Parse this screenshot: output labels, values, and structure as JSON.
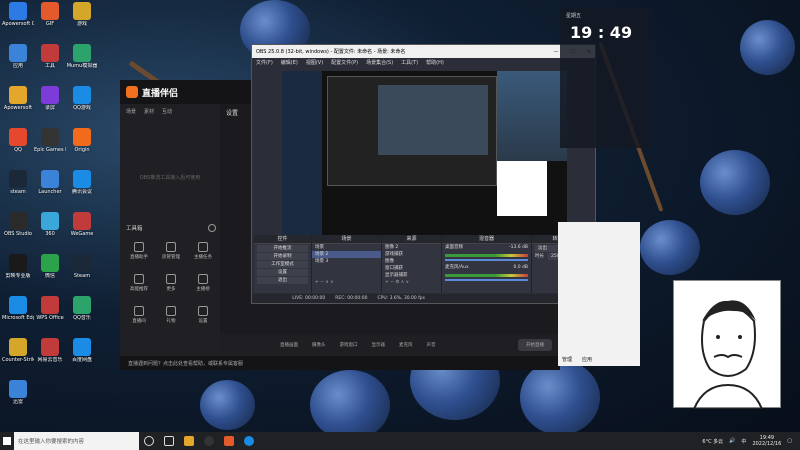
{
  "desktop": {
    "icons": [
      {
        "label": "Apowersoft GIF",
        "color": "#2c7be5"
      },
      {
        "label": "GIF",
        "color": "#e55a2c"
      },
      {
        "label": "游戏",
        "color": "#d4a62a"
      },
      {
        "label": "应用",
        "color": "#3b83d9"
      },
      {
        "label": "工具",
        "color": "#c23b3b"
      },
      {
        "label": "Mumu模拟器",
        "color": "#2ca36b"
      },
      {
        "label": "Apowersoft",
        "color": "#e5a62c"
      },
      {
        "label": "录屏",
        "color": "#7d3bd9"
      },
      {
        "label": "QQ游戏",
        "color": "#1b8ce5"
      },
      {
        "label": "QQ",
        "color": "#e5482c"
      },
      {
        "label": "Epic Games Launcher",
        "color": "#333333"
      },
      {
        "label": "Origin",
        "color": "#f26a1b"
      },
      {
        "label": "steam",
        "color": "#1b2838"
      },
      {
        "label": "Launcher",
        "color": "#3b83d9"
      },
      {
        "label": "腾讯会议",
        "color": "#1b8ce5"
      },
      {
        "label": "OBS Studio",
        "color": "#2a2a2a"
      },
      {
        "label": "360",
        "color": "#3ba6d9"
      },
      {
        "label": "WeGame",
        "color": "#c23b3b"
      },
      {
        "label": "剪映专业版",
        "color": "#1a1a1a"
      },
      {
        "label": "微信",
        "color": "#2ca34a"
      },
      {
        "label": "Steam",
        "color": "#1b2838"
      },
      {
        "label": "Microsoft Edge",
        "color": "#1b8ce5"
      },
      {
        "label": "WPS Office",
        "color": "#c23b3b"
      },
      {
        "label": "QQ音乐",
        "color": "#2ca36b"
      },
      {
        "label": "Counter-Strike: Global Offensive",
        "color": "#d4a62a"
      },
      {
        "label": "网易云音乐",
        "color": "#c23b3b"
      },
      {
        "label": "百度网盘",
        "color": "#1b8ce5"
      },
      {
        "label": "迅雷",
        "color": "#3b83d9"
      }
    ]
  },
  "companion": {
    "logo": "直播伴侣",
    "tabs": [
      "场景",
      "素材",
      "互动"
    ],
    "sidebar_heading": "工具箱",
    "tools": [
      "直播助手",
      "房管管理",
      "主播任务",
      "高能推荐",
      "更多",
      "主播榜",
      "直播间",
      "礼物",
      "设置"
    ],
    "empty_hint": "OBS推流工具接入后可使用",
    "status_text": "直播遇到问题？点击此处查看帮助，或联系专属客服",
    "bottom_buttons": [
      "直播画面",
      "摄像头",
      "游戏窗口",
      "显示器",
      "麦克风",
      "声音",
      "开始直播"
    ]
  },
  "obs": {
    "title": "OBS 25.0.8 (32-bit, windows) - 配置文件: 未命名 - 场景: 未命名",
    "menu": [
      "文件(F)",
      "编辑(E)",
      "视图(V)",
      "配置文件(P)",
      "场景集合(S)",
      "工具(T)",
      "帮助(H)"
    ],
    "docks": {
      "controls_title": "控件",
      "scenes_title": "场景",
      "sources_title": "来源",
      "mixer_title": "混音器",
      "transition_title": "转场特效",
      "scenes": [
        "场景",
        "场景 2",
        "场景 3"
      ],
      "sources": [
        "图像 2",
        "游戏捕获",
        "图像",
        "窗口捕获",
        "显示器捕获"
      ],
      "controls": [
        "开始推流",
        "开始录制",
        "工作室模式",
        "设置",
        "退出"
      ],
      "mixer": [
        {
          "name": "桌面音频",
          "db": "-13.6 dB"
        },
        {
          "name": "麦克风/Aux",
          "db": "0.0 dB"
        }
      ],
      "transition": {
        "type": "淡出",
        "duration_label": "时长",
        "duration": "250 ms"
      }
    },
    "status": [
      "LIVE: 00:00:00",
      "REC: 00:00:00",
      "CPU: 3.6%, 30.00 fps"
    ]
  },
  "right_panel": {
    "date_label": "星期五",
    "clock": "19 : 49",
    "chat_footer": [
      "管理",
      "应用"
    ]
  },
  "taskbar": {
    "search_placeholder": "在这里输入你要搜索的内容",
    "weather": "6°C  多云",
    "time": "19:49",
    "date": "2022/12/16",
    "lang": "中"
  }
}
